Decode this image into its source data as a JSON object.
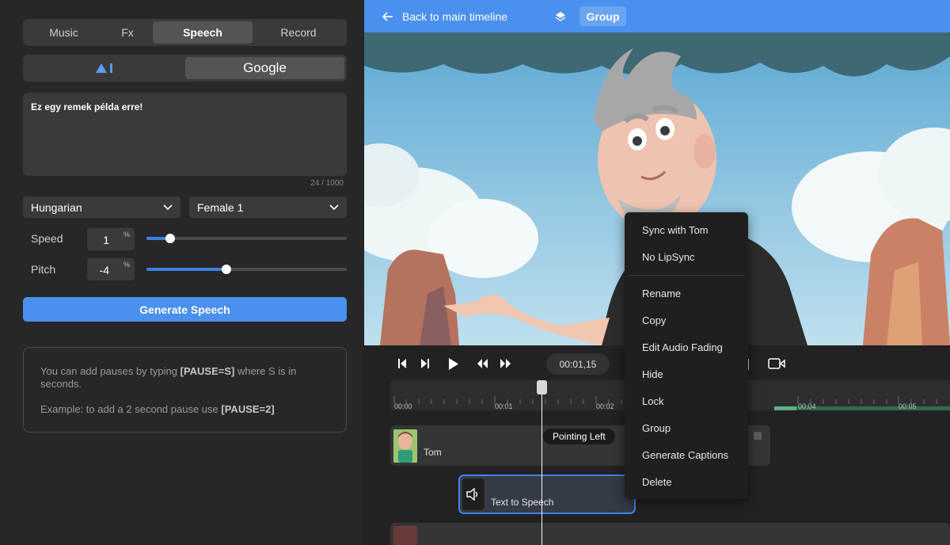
{
  "left_panel": {
    "tabs": [
      {
        "label": "Music"
      },
      {
        "label": "Fx"
      },
      {
        "label": "Speech"
      },
      {
        "label": "Record"
      }
    ],
    "providers": {
      "google_label": "Google"
    },
    "textarea": {
      "value": "Ez egy remek példa erre!",
      "counter": "24 / 1000"
    },
    "language_select": {
      "value": "Hungarian"
    },
    "voice_select": {
      "value": "Female 1"
    },
    "speed": {
      "label": "Speed",
      "value": "1",
      "unit": "%",
      "level": 0.12
    },
    "pitch": {
      "label": "Pitch",
      "value": "-4",
      "unit": "%",
      "level": 0.4
    },
    "generate_button": "Generate Speech",
    "info": {
      "line1_pre": "You can add pauses by typing ",
      "line1_code": "[PAUSE=S]",
      "line1_post": " where S is in seconds.",
      "line2_pre": "Example: to add a 2 second pause use ",
      "line2_code": "[PAUSE=2]"
    }
  },
  "topbar": {
    "back_label": "Back to main timeline",
    "group_label": "Group"
  },
  "player": {
    "timecode": "00:01,15"
  },
  "timeline": {
    "ticks": [
      "00:00",
      "00:01",
      "00:02",
      "00:04",
      "00:05"
    ],
    "track_character": {
      "name": "Tom",
      "action_label": "Pointing Left"
    },
    "track_audio": {
      "label": "Text to Speech"
    }
  },
  "context_menu": {
    "items_top": [
      "Sync with Tom",
      "No LipSync"
    ],
    "items_bottom": [
      "Rename",
      "Copy",
      "Edit Audio Fading",
      "Hide",
      "Lock",
      "Group",
      "Generate Captions",
      "Delete"
    ]
  },
  "colors": {
    "accent": "#4a90ee",
    "panel": "#272727",
    "surface": "#3a3a3a"
  },
  "icons": [
    "back-arrow-icon",
    "layers-icon",
    "skip-start-icon",
    "step-forward-icon",
    "play-icon",
    "rewind-icon",
    "fast-forward-icon",
    "camera-icon",
    "chevron-down-icon",
    "speaker-icon",
    "provider-logo-icon"
  ]
}
